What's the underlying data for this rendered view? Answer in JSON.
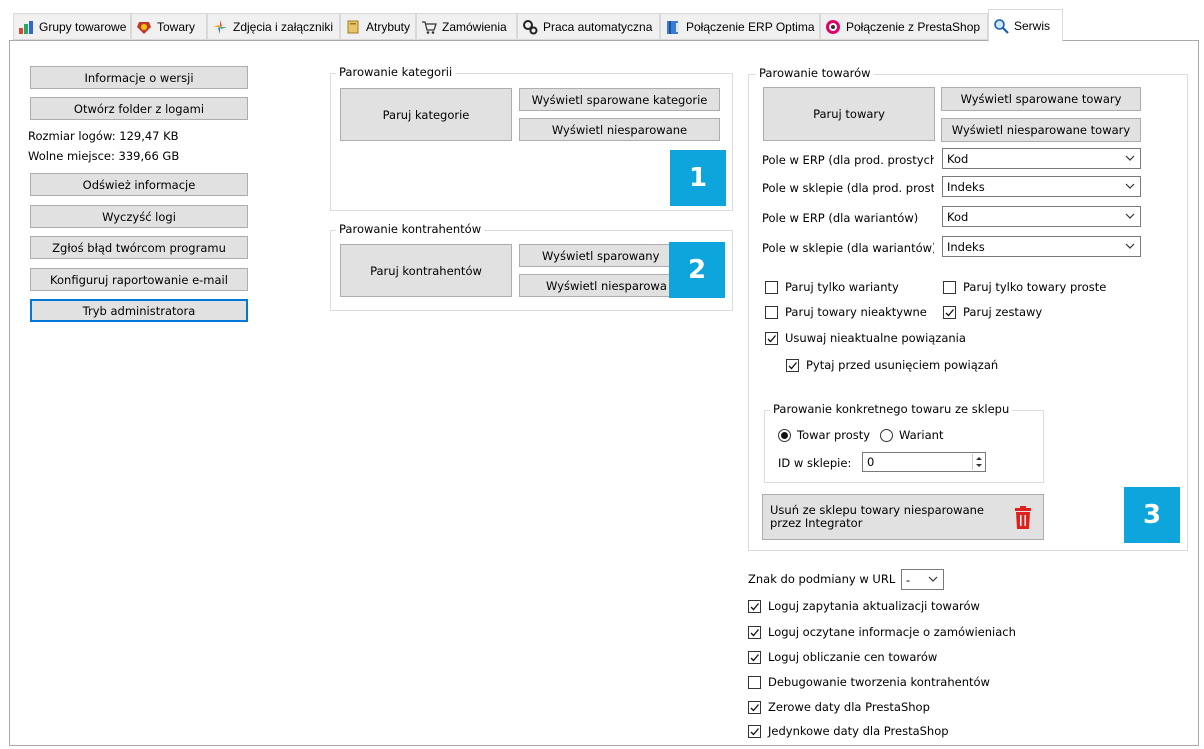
{
  "tabs": [
    {
      "label": "Grupy towarowe",
      "icon": "groups-icon"
    },
    {
      "label": "Towary",
      "icon": "products-icon"
    },
    {
      "label": "Zdjęcia i załączniki",
      "icon": "images-icon"
    },
    {
      "label": "Atrybuty",
      "icon": "attributes-icon"
    },
    {
      "label": "Zamówienia",
      "icon": "cart-icon"
    },
    {
      "label": "Praca automatyczna",
      "icon": "gears-icon"
    },
    {
      "label": "Połączenie ERP Optima",
      "icon": "erp-book-icon"
    },
    {
      "label": "Połączenie z PrestaShop",
      "icon": "prestashop-icon"
    },
    {
      "label": "Serwis",
      "icon": "magnifier-icon"
    }
  ],
  "left": {
    "info_version": "Informacje o wersji",
    "open_logs": "Otwórz folder z logami",
    "log_size": "Rozmiar logów: 129,47 KB",
    "free_space": "Wolne miejsce: 339,66 GB",
    "refresh": "Odśwież informacje",
    "clear_logs": "Wyczyść logi",
    "report_bug": "Zgłoś błąd twórcom programu",
    "email_report": "Konfiguruj raportowanie e-mail",
    "admin_mode": "Tryb administratora"
  },
  "categories": {
    "title": "Parowanie kategorii",
    "pair": "Paruj kategorie",
    "show_paired": "Wyświetl sparowane kategorie",
    "show_unpaired": "Wyświetl niesparowane",
    "badge": "1"
  },
  "contractors": {
    "title": "Parowanie kontrahentów",
    "pair": "Paruj kontrahentów",
    "show_paired": "Wyświetl sparowany",
    "show_unpaired": "Wyświetl niesparowa",
    "badge": "2"
  },
  "products": {
    "title": "Parowanie towarów",
    "pair": "Paruj towary",
    "show_paired": "Wyświetl sparowane towary",
    "show_unpaired": "Wyświetl niesparowane towary",
    "fields": [
      {
        "label": "Pole w ERP (dla prod. prostych)",
        "value": "Kod"
      },
      {
        "label": "Pole w sklepie (dla prod. prostyc",
        "value": "Indeks"
      },
      {
        "label": "Pole w ERP (dla wariantów)",
        "value": "Kod"
      },
      {
        "label": "Pole w sklepie (dla wariantów)",
        "value": "Indeks"
      }
    ],
    "checks": [
      {
        "label": "Paruj tylko warianty",
        "checked": false
      },
      {
        "label": "Paruj tylko towary proste",
        "checked": false
      },
      {
        "label": "Paruj towary nieaktywne",
        "checked": false
      },
      {
        "label": "Paruj zestawy",
        "checked": true
      },
      {
        "label": "Usuwaj nieaktualne powiązania",
        "checked": true
      },
      {
        "label": "Pytaj przed usunięciem powiązań",
        "checked": true
      }
    ],
    "specific": {
      "title": "Parowanie konkretnego towaru ze sklepu",
      "radio_simple": "Towar prosty",
      "radio_variant": "Wariant",
      "id_label": "ID w sklepie:",
      "id_value": "0"
    },
    "delete_btn": "Usuń ze sklepu towary niesparowane przez Integrator",
    "badge": "3"
  },
  "bottom": {
    "url_char_label": "Znak do podmiany w URL",
    "url_char_value": "-",
    "checks": [
      {
        "label": "Loguj zapytania aktualizacji towarów",
        "checked": true
      },
      {
        "label": "Loguj oczytane informacje o zamówieniach",
        "checked": true
      },
      {
        "label": "Loguj obliczanie cen towarów",
        "checked": true
      },
      {
        "label": "Debugowanie tworzenia kontrahentów",
        "checked": false
      },
      {
        "label": "Zerowe daty dla PrestaShop",
        "checked": true
      },
      {
        "label": "Jedynkowe daty dla PrestaShop",
        "checked": true
      }
    ]
  },
  "colors": {
    "badge": "#0ea5dd",
    "focus": "#0078d7",
    "trash": "#e0201c"
  }
}
